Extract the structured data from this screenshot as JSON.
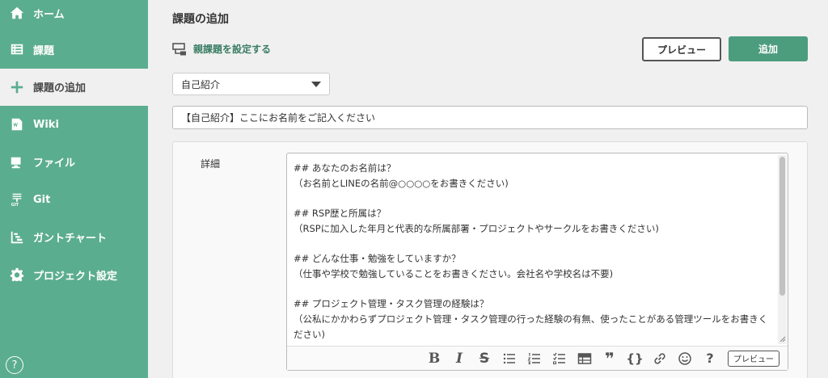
{
  "sidebar": {
    "items": [
      {
        "label": "ホーム",
        "icon": "home-icon"
      },
      {
        "label": "課題",
        "icon": "list-icon"
      },
      {
        "label": "課題の追加",
        "icon": "plus-icon",
        "active": true
      },
      {
        "label": "Wiki",
        "icon": "wiki-icon"
      },
      {
        "label": "ファイル",
        "icon": "folder-icon"
      },
      {
        "label": "Git",
        "icon": "git-icon"
      },
      {
        "label": "ガントチャート",
        "icon": "gantt-icon"
      },
      {
        "label": "プロジェクト設定",
        "icon": "gear-icon"
      }
    ],
    "help": "?"
  },
  "main": {
    "title": "課題の追加",
    "parent_link": "親課題を設定する",
    "preview_label": "プレビュー",
    "add_label": "追加",
    "template_select": "自己紹介",
    "title_value": "【自己紹介】ここにお名前をご記入ください",
    "detail_label": "詳細",
    "editor_text": "## あなたのお名前は？\n（お名前とLINEの名前@○○○○をお書きください)\n\n## RSP歴と所属は？\n（RSPに加入した年月と代表的な所属部署・プロジェクトやサークルをお書きください)\n\n## どんな仕事・勉強をしていますか？\n（仕事や学校で勉強していることをお書きください。会社名や学校名は不要)\n\n## プロジェクト管理・タスク管理の経験は？\n（公私にかかわらずプロジェクト管理・タスク管理の行った経験の有無、使ったことがある管理ツールをお書きください)",
    "toolbar": {
      "bold": "B",
      "italic": "I",
      "strike": "S",
      "quote": "❞",
      "code": "{}",
      "help": "?",
      "preview": "プレビュー"
    }
  },
  "colors": {
    "sidebar": "#5bad8f",
    "accent": "#4c9c7e"
  }
}
